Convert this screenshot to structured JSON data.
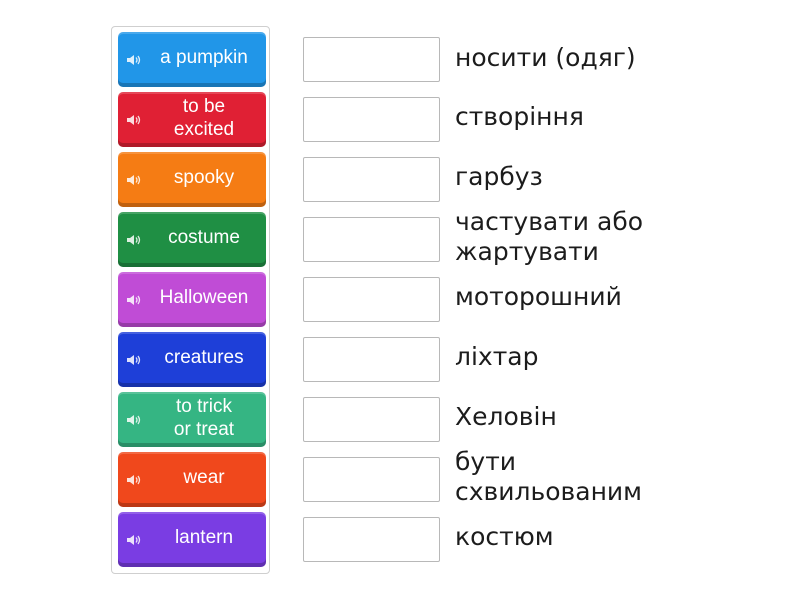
{
  "tiles": [
    {
      "label": "a pumpkin",
      "color": "#2196e8"
    },
    {
      "label": "to be\nexcited",
      "color": "#e02034"
    },
    {
      "label": "spooky",
      "color": "#f57c14"
    },
    {
      "label": "costume",
      "color": "#1f8f44"
    },
    {
      "label": "Halloween",
      "color": "#c04cd6"
    },
    {
      "label": "creatures",
      "color": "#1e3fd8"
    },
    {
      "label": "to trick\nor treat",
      "color": "#35b583"
    },
    {
      "label": "wear",
      "color": "#f0481c"
    },
    {
      "label": "lantern",
      "color": "#7a3de3"
    }
  ],
  "tile_icon": "speaker-icon",
  "definitions": [
    "носити (одяг)",
    "створіння",
    "гарбуз",
    "частувати або\nжартувати",
    "моторошний",
    "ліхтар",
    "Хеловін",
    "бути\nсхвильованим",
    "костюм"
  ]
}
